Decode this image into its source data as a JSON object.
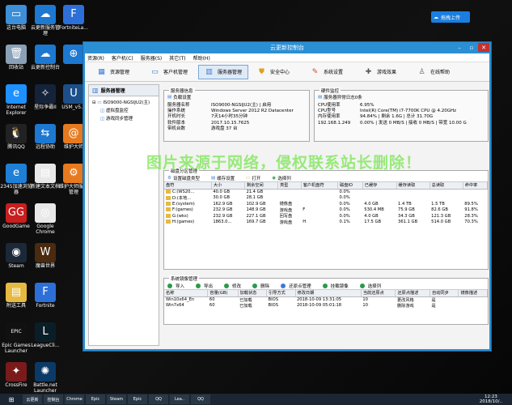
{
  "desktop_icons_left": [
    {
      "label": "这台电脑",
      "icon": "computer-icon",
      "color": "#3c8fd8",
      "glyph": "▭"
    },
    {
      "label": "回收站",
      "icon": "recycle-bin-icon",
      "color": "#8aa0b6",
      "glyph": "🗑"
    },
    {
      "label": "Internet Explorer",
      "icon": "ie-icon",
      "color": "#1e90ff",
      "glyph": "e"
    },
    {
      "label": "腾讯QQ",
      "icon": "qq-icon",
      "color": "#222",
      "glyph": "🐧"
    },
    {
      "label": "2345加速浏览器",
      "icon": "browser-2345-icon",
      "color": "#1e7fd6",
      "glyph": "e"
    },
    {
      "label": "GoodGame",
      "icon": "goodgame-icon",
      "color": "#c81e1e",
      "glyph": "GG"
    },
    {
      "label": "Steam",
      "icon": "steam-icon",
      "color": "#1b2838",
      "glyph": "◉"
    },
    {
      "label": "附送工具",
      "icon": "tools-folder-icon",
      "color": "#e6b940",
      "glyph": "▤"
    },
    {
      "label": "Epic Games Launcher",
      "icon": "epic-icon",
      "color": "#111",
      "glyph": "EPIC"
    },
    {
      "label": "CrossFire",
      "icon": "crossfire-icon",
      "color": "#7a1a1a",
      "glyph": "✦"
    }
  ],
  "desktop_icons_mid": [
    {
      "label": "云更新服务管理",
      "icon": "cloud-service-icon",
      "color": "#1c78d0",
      "glyph": "☁"
    },
    {
      "label": "云更新控制台",
      "icon": "cloud-console-icon",
      "color": "#1c78d0",
      "glyph": "☁"
    },
    {
      "label": "星际争霸II",
      "icon": "starcraft-icon",
      "color": "#14233a",
      "glyph": "✧"
    },
    {
      "label": "远程协助",
      "icon": "remote-assist-icon",
      "color": "#1c78d0",
      "glyph": "⇆"
    },
    {
      "label": "新建文本文档",
      "icon": "text-document-icon",
      "color": "#e8e8e8",
      "glyph": "▤"
    },
    {
      "label": "Google Chrome",
      "icon": "chrome-icon",
      "color": "#e9e9e9",
      "glyph": "◎"
    },
    {
      "label": "魔兽世界",
      "icon": "wow-icon",
      "color": "#4a2a10",
      "glyph": "W"
    },
    {
      "label": "Fortnite",
      "icon": "fortnite-icon",
      "color": "#2d6fd8",
      "glyph": "F"
    },
    {
      "label": "LeagueCli...",
      "icon": "league-icon",
      "color": "#0a1e28",
      "glyph": "L"
    },
    {
      "label": "Battle.net Launcher",
      "icon": "battlenet-icon",
      "color": "#0b3a66",
      "glyph": "✺"
    }
  ],
  "desktop_icons_right": [
    {
      "label": "FortniteLa...",
      "icon": "fortnite-launcher-icon",
      "color": "#2d6fd8",
      "glyph": "F"
    },
    {
      "label": "",
      "icon": "cloud-app-icon",
      "color": "#1c78d0",
      "glyph": "⊕"
    },
    {
      "label": "USM_v5...",
      "icon": "usm-icon",
      "color": "#1c4f8a",
      "glyph": "U"
    },
    {
      "label": "维护大师",
      "icon": "maintain-icon",
      "color": "#e77a1e",
      "glyph": "@"
    },
    {
      "label": "维护大师服务管理",
      "icon": "maintain-service-icon",
      "color": "#e77a1e",
      "glyph": "⚙"
    }
  ],
  "cloud_upload": "拖拽上传",
  "window": {
    "title": "云更新控制台",
    "menu": [
      "资源(R)",
      "客户机(C)",
      "服务器(S)",
      "其它(T)",
      "帮助(H)"
    ],
    "toolbar": [
      {
        "label": "资源管理",
        "icon": "resource-icon",
        "glyph": "▦",
        "color": "#3a7bd5"
      },
      {
        "label": "客户机管理",
        "icon": "client-icon",
        "glyph": "▭",
        "color": "#3a7bd5"
      },
      {
        "label": "服务器管理",
        "icon": "server-icon",
        "glyph": "▥",
        "color": "#3a7bd5"
      },
      {
        "label": "安全中心",
        "icon": "shield-icon",
        "glyph": "⛊",
        "color": "#e0a020"
      },
      {
        "label": "系统设置",
        "icon": "settings-icon",
        "glyph": "✎",
        "color": "#d04a2a"
      },
      {
        "label": "游戏效果",
        "icon": "game-effect-icon",
        "glyph": "✚",
        "color": "#555"
      },
      {
        "label": "在线帮助",
        "icon": "help-icon",
        "glyph": "♙",
        "color": "#666"
      }
    ],
    "active_tab_index": 2,
    "left_panel": {
      "title": "服务器管理",
      "tree_root": "ISO9000-NGSIJU2(主)",
      "tree_children": [
        "虚拟盘监控",
        "游戏同步管理"
      ]
    },
    "server_info": {
      "title": "服务器信息",
      "load_config": "负载设置",
      "rows": [
        {
          "k": "服务器名称",
          "v": "ISO9000-NGSIJU2(主) | 启用"
        },
        {
          "k": "操作系统",
          "v": "Windows Server 2012 R2 Datacenter"
        },
        {
          "k": "开机时长",
          "v": "7天14小时35分钟"
        },
        {
          "k": "软件版本",
          "v": "2017.10.15.7625"
        },
        {
          "k": "带机台数",
          "v": "游戏盘 37 台"
        }
      ]
    },
    "hardware": {
      "title": "硬件监控",
      "log_link": "服务器异常日志0条",
      "rows": [
        {
          "k": "CPU使用率",
          "v": "6.95%"
        },
        {
          "k": "CPU型号",
          "v": "Intel(R) Core(TM) i7-7700K CPU @ 4.20GHz"
        },
        {
          "k": "内存使用率",
          "v": "94.84% | 剩余 1.6G | 总计 31.70G"
        },
        {
          "k": "192.168.1.249",
          "v": "0.00% | 发送 0 MB/S | 接收 0 MB/S | 带宽 10.00 G"
        }
      ]
    },
    "disk": {
      "title": "磁盘分区管理",
      "actions": [
        "设置磁盘类型",
        "缓存设置",
        "打开",
        "选择列"
      ],
      "columns": [
        "盘符",
        "大小",
        "剩余空间",
        "类型",
        "客户机盘符",
        "磁盘IO",
        "已缓存",
        "缓存读取",
        "总读取",
        "命中率"
      ],
      "rows": [
        [
          "C:(WS20...",
          "40.0 GB",
          "21.4 GB",
          "",
          "",
          "0.0%",
          "",
          "",
          "",
          ""
        ],
        [
          "D:(本地...",
          "30.0 GB",
          "28.1 GB",
          "",
          "",
          "0.0%",
          "",
          "",
          "",
          ""
        ],
        [
          "E:(system)",
          "162.9 GB",
          "102.9 GB",
          "镜像盘",
          "",
          "0.0%",
          "4.0 GB",
          "1.4 TB",
          "1.5 TB",
          "89.5%"
        ],
        [
          "F:(games)",
          "232.9 GB",
          "148.9 GB",
          "游戏盘",
          "F",
          "0.0%",
          "530.4 MB",
          "75.9 GB",
          "82.6 GB",
          "91.8%"
        ],
        [
          "G:(wks)",
          "232.9 GB",
          "227.1 GB",
          "回写盘",
          "",
          "0.0%",
          "4.0 GB",
          "34.3 GB",
          "121.3 GB",
          "28.3%"
        ],
        [
          "H:(games)",
          "1863.0...",
          "169.7 GB",
          "游戏盘",
          "H",
          "0.1%",
          "17.5 GB",
          "361.1 GB",
          "514.0 GB",
          "70.3%"
        ]
      ]
    },
    "mirror": {
      "title": "系统镜像管理",
      "actions": [
        "导入",
        "导出",
        "修改",
        "删除",
        "还原点管理",
        "挂载镜像",
        "选择列"
      ],
      "columns": [
        "名称",
        "容量(GB)",
        "加载状态",
        "引导方式",
        "修改日期",
        "当前还原点",
        "还原点描述",
        "自动同步",
        "镜像描述"
      ],
      "rows": [
        [
          "Win10x64_En",
          "60",
          "已加载",
          "BIOS",
          "2018-10-09 13:31:05",
          "10",
          "更改风格",
          "是",
          ""
        ],
        [
          "Win7x64",
          "60",
          "已加载",
          "BIOS",
          "2018-10-09 05:01:18",
          "10",
          "删除游戏",
          "是",
          ""
        ]
      ]
    }
  },
  "watermark": "图片来源于网络，侵权联系站长删除！",
  "taskbar": {
    "items": [
      "云更新",
      "控制台",
      "Chrome",
      "Epic",
      "Steam",
      "Epic",
      "QQ",
      "Lea..",
      "QQ"
    ],
    "time": "12:23",
    "date": "2018/10/.."
  }
}
